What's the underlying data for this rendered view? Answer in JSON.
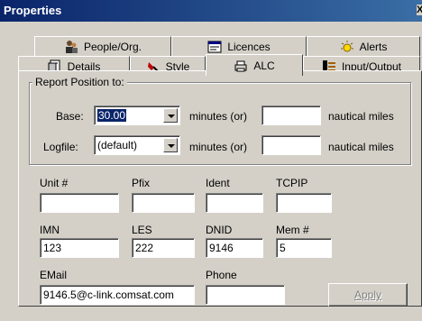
{
  "window": {
    "title": "Properties",
    "close_glyph": "X"
  },
  "tabs": {
    "back_row": [
      {
        "label": "People/Org.",
        "icon": "people-icon"
      },
      {
        "label": "Licences",
        "icon": "licence-icon"
      },
      {
        "label": "Alerts",
        "icon": "alert-icon"
      }
    ],
    "front_row": [
      {
        "label": "Details",
        "icon": "details-icon"
      },
      {
        "label": "Style",
        "icon": "style-icon"
      },
      {
        "label": "ALC",
        "icon": "alc-icon",
        "active": true
      },
      {
        "label": "Input/Output",
        "icon": "input-output-icon"
      }
    ]
  },
  "report_position": {
    "legend": "Report Position to:",
    "base": {
      "label": "Base:",
      "value": "30.00",
      "minutes_label": "minutes (or)",
      "nm_value": "",
      "nm_label": "nautical miles"
    },
    "logfile": {
      "label": "Logfile:",
      "value": "(default)",
      "minutes_label": "minutes (or)",
      "nm_value": "",
      "nm_label": "nautical miles"
    }
  },
  "fields": {
    "unit": {
      "label": "Unit #",
      "value": ""
    },
    "pfix": {
      "label": "Pfix",
      "value": ""
    },
    "ident": {
      "label": "Ident",
      "value": ""
    },
    "tcpip": {
      "label": "TCPIP",
      "value": ""
    },
    "imn": {
      "label": "IMN",
      "value": "123"
    },
    "les": {
      "label": "LES",
      "value": "222"
    },
    "dnid": {
      "label": "DNID",
      "value": "9146"
    },
    "mem": {
      "label": "Mem #",
      "value": "5"
    },
    "email": {
      "label": "EMail",
      "value": "9146.5@c-link.comsat.com"
    },
    "phone": {
      "label": "Phone",
      "value": ""
    }
  },
  "buttons": {
    "apply": "Apply"
  },
  "colors": {
    "titlebar_start": "#0a246a",
    "titlebar_end": "#3a6ea5",
    "face": "#d4d0c8",
    "selection": "#0a246a"
  }
}
